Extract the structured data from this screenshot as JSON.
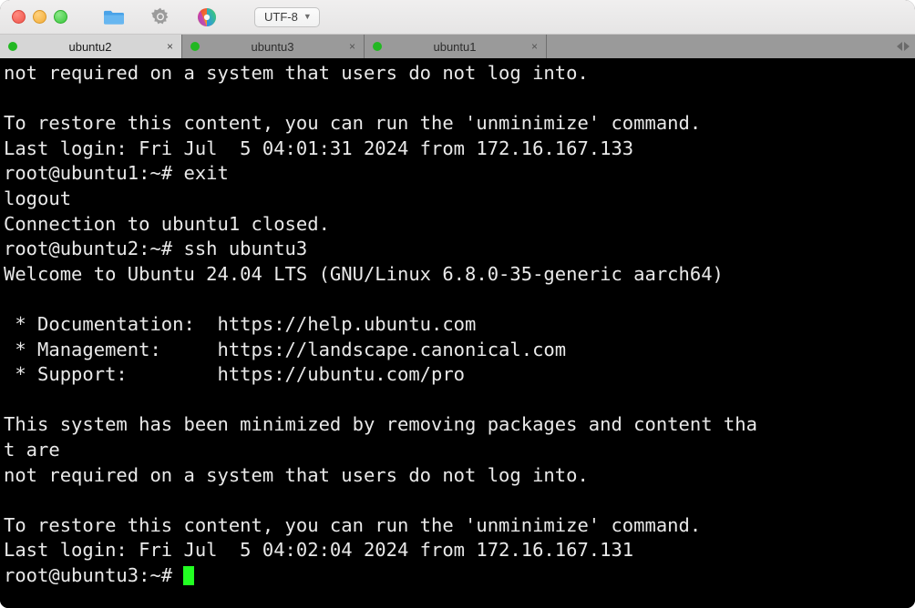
{
  "window": {
    "traffic_lights": [
      "close",
      "minimize",
      "maximize"
    ]
  },
  "toolbar": {
    "icons": [
      {
        "name": "folder-icon",
        "label": "Folder"
      },
      {
        "name": "gear-icon",
        "label": "Settings"
      },
      {
        "name": "color-wheel-icon",
        "label": "Colors"
      }
    ],
    "encoding": {
      "label": "UTF-8",
      "chevron": "⌄"
    }
  },
  "tabs": {
    "items": [
      {
        "label": "ubuntu2",
        "active": true,
        "status_color": "#22b822",
        "close": "×"
      },
      {
        "label": "ubuntu3",
        "active": false,
        "status_color": "#22b822",
        "close": "×"
      },
      {
        "label": "ubuntu1",
        "active": false,
        "status_color": "#22b822",
        "close": "×"
      }
    ],
    "scroll_left": "◀",
    "scroll_right": "▶"
  },
  "terminal": {
    "background": "#000000",
    "foreground": "#e9e9e9",
    "cursor_color": "#22ff22",
    "lines": [
      "not required on a system that users do not log into.",
      "",
      "To restore this content, you can run the 'unminimize' command.",
      "Last login: Fri Jul  5 04:01:31 2024 from 172.16.167.133",
      "root@ubuntu1:~# exit",
      "logout",
      "Connection to ubuntu1 closed.",
      "root@ubuntu2:~# ssh ubuntu3",
      "Welcome to Ubuntu 24.04 LTS (GNU/Linux 6.8.0-35-generic aarch64)",
      "",
      " * Documentation:  https://help.ubuntu.com",
      " * Management:     https://landscape.canonical.com",
      " * Support:        https://ubuntu.com/pro",
      "",
      "This system has been minimized by removing packages and content tha",
      "t are",
      "not required on a system that users do not log into.",
      "",
      "To restore this content, you can run the 'unminimize' command.",
      "Last login: Fri Jul  5 04:02:04 2024 from 172.16.167.131"
    ],
    "prompt": "root@ubuntu3:~# "
  }
}
